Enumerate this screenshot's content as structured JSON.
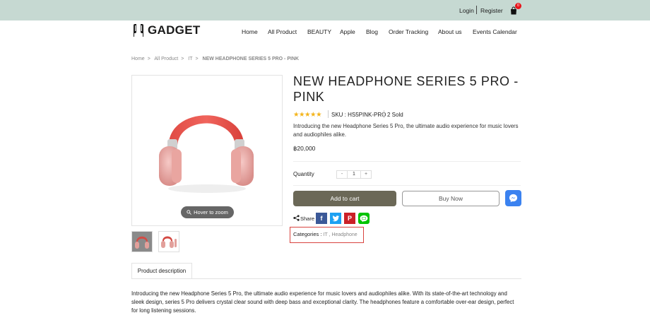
{
  "topbar": {
    "login": "Login",
    "register": "Register",
    "cart_count": "0"
  },
  "brand": {
    "name": "GADGET"
  },
  "nav": [
    "Home",
    "All Product",
    "BEAUTY",
    "Apple",
    "Blog",
    "Order Tracking",
    "About us",
    "Events Calendar"
  ],
  "breadcrumb": [
    "Home",
    "All Product",
    "IT",
    "NEW HEADPHONE SERIES 5 PRO - PINK"
  ],
  "product": {
    "title_line1": "NEW HEADPHONE SERIES 5 PRO -",
    "title_line2": "PINK",
    "rating_stars": 5,
    "sku": "SKU : HS5PINK-PRO",
    "sold": "2 Sold",
    "short_description": "Introducing the new Headphone Series 5 Pro, the ultimate audio experience for music lovers and audiophiles alike.",
    "price": "฿20,000",
    "quantity_label": "Quantity",
    "quantity_value": "1",
    "minus": "-",
    "plus": "+",
    "add_to_cart": "Add to cart",
    "buy_now": "Buy Now",
    "zoom_hint": "Hover to zoom",
    "share_label": "Share",
    "categories_label": "Categories :",
    "categories": "IT , Headphone"
  },
  "tabs": {
    "description": "Product description"
  },
  "long_description": "Introducing the new Headphone Series 5 Pro, the ultimate audio experience for music lovers and audiophiles alike. With its state-of-the-art technology and sleek design, series 5 Pro delivers crystal clear sound with deep bass and exceptional clarity. The headphones feature a comfortable over-ear design, perfect for long listening sessions.",
  "colors": {
    "topbar": "#c6d9d2",
    "add_to_cart": "#6b6857",
    "messenger": "#3b82f0",
    "highlight_box": "#d9443f",
    "stars": "#f4b41a"
  }
}
